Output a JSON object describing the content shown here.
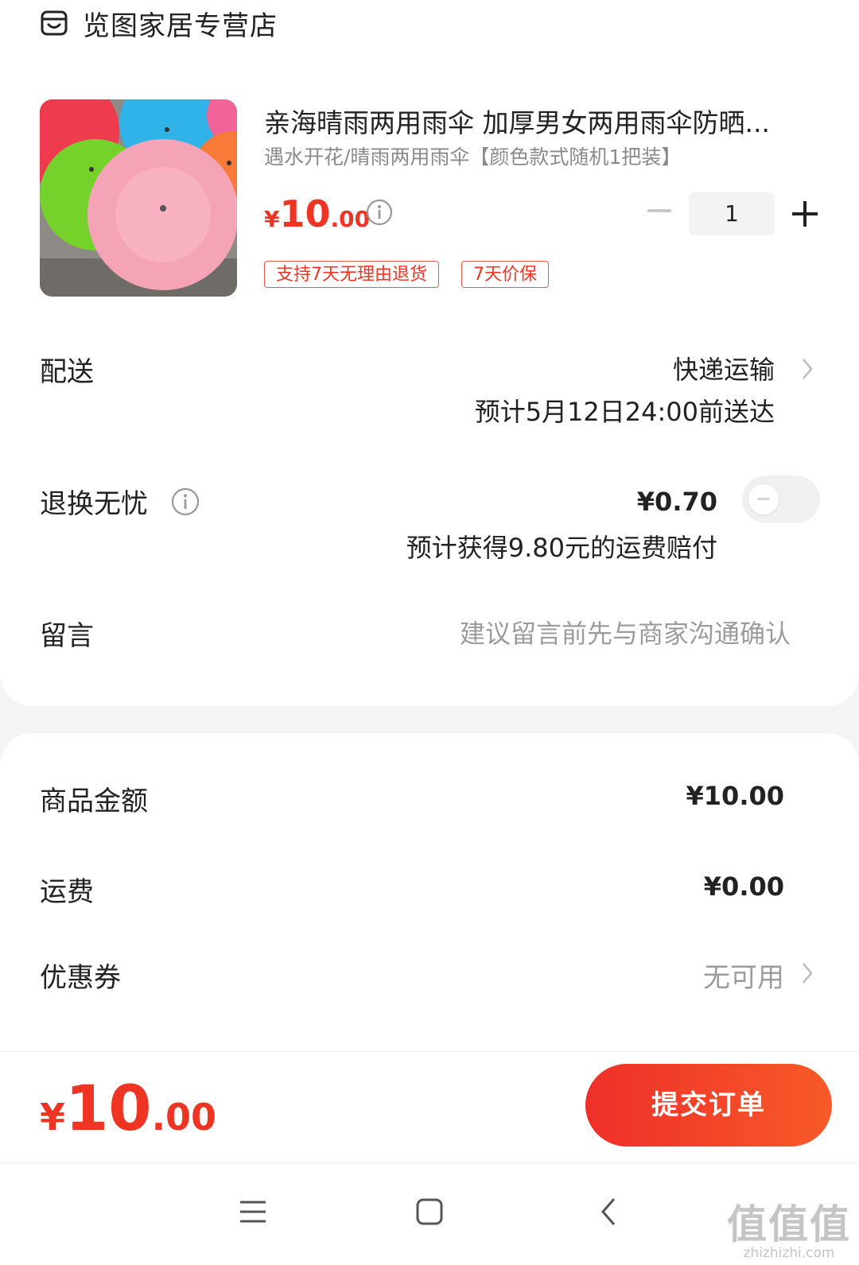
{
  "store": {
    "name": "览图家居专营店",
    "icon": "store-icon"
  },
  "product": {
    "title": "亲海晴雨两用雨伞 加厚男女两用雨伞防晒...",
    "subtitle": "遇水开花/晴雨两用雨伞【颜色款式随机1把装】",
    "price_currency": "¥",
    "price_int": "10",
    "price_dec": ".00",
    "quantity": "1",
    "tags": [
      "支持7天无理由退货",
      "7天价保"
    ],
    "accent_color": "#ee3524"
  },
  "delivery": {
    "label": "配送",
    "method": "快递运输",
    "eta": "预计5月12日24:00前送达"
  },
  "return_insurance": {
    "label": "退换无忧",
    "price": "¥0.70",
    "note": "预计获得9.80元的运费赔付",
    "enabled": false
  },
  "message": {
    "label": "留言",
    "placeholder": "建议留言前先与商家沟通确认"
  },
  "summary": {
    "goods_label": "商品金额",
    "goods_value": "¥10.00",
    "shipping_label": "运费",
    "shipping_value": "¥0.00",
    "coupon_label": "优惠券",
    "coupon_value": "无可用"
  },
  "footer": {
    "total_currency": "¥",
    "total_int": "10",
    "total_dec": ".00",
    "submit_label": "提交订单"
  },
  "watermark": {
    "big": "值值值",
    "small": "zhizhizhi.com"
  }
}
